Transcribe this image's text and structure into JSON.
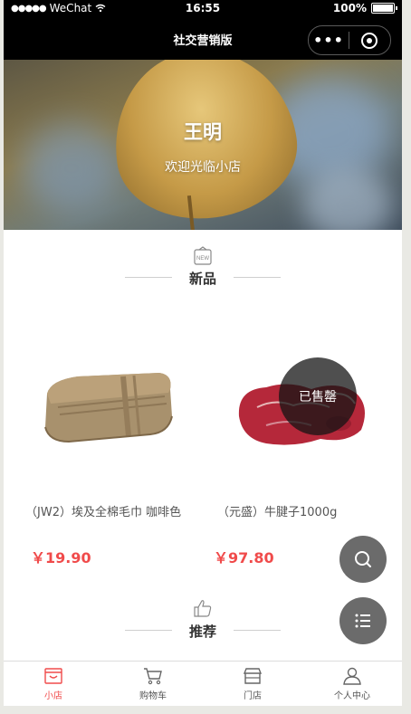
{
  "status_bar": {
    "carrier": "WeChat",
    "time": "16:55",
    "battery": "100%"
  },
  "nav_bar": {
    "title": "社交营销版"
  },
  "hero": {
    "name": "王明",
    "subtitle": "欢迎光临小店"
  },
  "sections": [
    {
      "title": "新品",
      "icon": "new-tag-icon"
    },
    {
      "title": "推荐",
      "icon": "thumbs-up-icon"
    }
  ],
  "products": [
    {
      "name": "（JW2）埃及全棉毛巾 咖啡色",
      "price": "￥19.90",
      "sold_out": false
    },
    {
      "name": "（元盛）牛腱子1000g",
      "price": "￥97.80",
      "sold_out": true,
      "sold_out_label": "已售罄"
    }
  ],
  "floating_buttons": [
    {
      "icon": "search-icon"
    },
    {
      "icon": "list-icon"
    }
  ],
  "tab_bar": {
    "items": [
      {
        "label": "小店",
        "icon": "shop-bag-icon",
        "active": true
      },
      {
        "label": "购物车",
        "icon": "cart-icon",
        "active": false
      },
      {
        "label": "门店",
        "icon": "store-icon",
        "active": false
      },
      {
        "label": "个人中心",
        "icon": "user-icon",
        "active": false
      }
    ]
  },
  "colors": {
    "accent": "#f04b4b",
    "nav_bg": "#000000",
    "fab": "#6b6b6b"
  }
}
